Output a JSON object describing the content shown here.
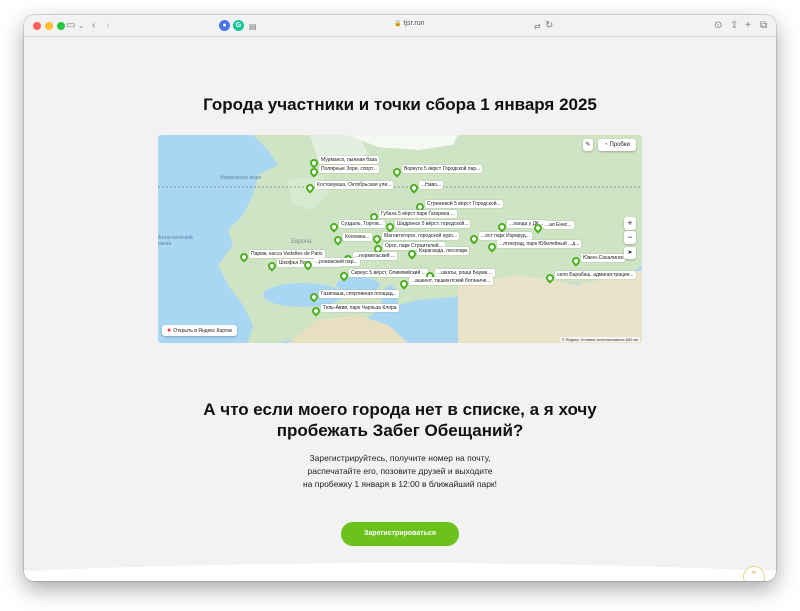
{
  "browser": {
    "url": "tjsr.run",
    "icons": [
      "sidebar-icon",
      "back-icon",
      "forward-icon",
      "shield-icon",
      "grammarly-icon",
      "translate-icon",
      "reload-icon",
      "download-icon",
      "share-icon",
      "new-tab-icon",
      "tabs-icon"
    ]
  },
  "page": {
    "title": "Города участники и точки сбора 1 января 2025",
    "question_line1": "А что если моего города нет в списке, а я хочу",
    "question_line2": "пробежать Забег Обещаний?",
    "desc_line1": "Зарегистрируйтесь, получите номер на почту,",
    "desc_line2": "распечатайте его, позовите друзей и выходите",
    "desc_line3": "на пробежку 1 января в 12:00 в ближайший парк!",
    "cta_label": "Зарегистрироваться",
    "accent_color": "#6ac21a"
  },
  "map": {
    "traffic_label": "Пробки",
    "open_label": "Открыть в Яндекс Картах",
    "zoom_in": "+",
    "zoom_out": "−",
    "copyright": "© Яндекс   Условия использования   800 км",
    "region_labels": [
      "Норвежское море",
      "Атлантический океан",
      "Европа"
    ],
    "pins": [
      "Мурманск, лыжная база",
      "Полярные Зори, спорт...",
      "Воркута 5 вёрст Городской пар...",
      "Костомукша, Октябрьская ули...",
      "...Наво...",
      "Стрежевой 5 вёрст Городской...",
      "Губаха 5 вёрст парк Гагарина ...",
      "Суздаль, Торгов...",
      "Шадринск 5 вёрст, городской...",
      "...ланда у ДК ...",
      "...ая Енис...",
      "Коломна...",
      "Магнитогорск, городской куро...",
      "...ост парк Изумруд...",
      "Орск, парк Строителей...",
      "...лгинград, парк Юбилейный ...д...",
      "Париж, касса Vedettes de Paris",
      "Караганда, лесопарк",
      "...нормильский ...",
      "Южно-Сахалинск",
      "Шкофья Лока, Celtiskiy trg",
      "...ронежский пар...",
      "Сириус 5 вёрст, Олимпийский ...",
      "...шкаты, роща Баума ...",
      "...ашкент, ташкентский ботаниче...",
      "село Барабаш, администрация...",
      "Газипаша, спортивная площад...",
      "Тель-Авив, парк Чарльза Клора"
    ]
  }
}
